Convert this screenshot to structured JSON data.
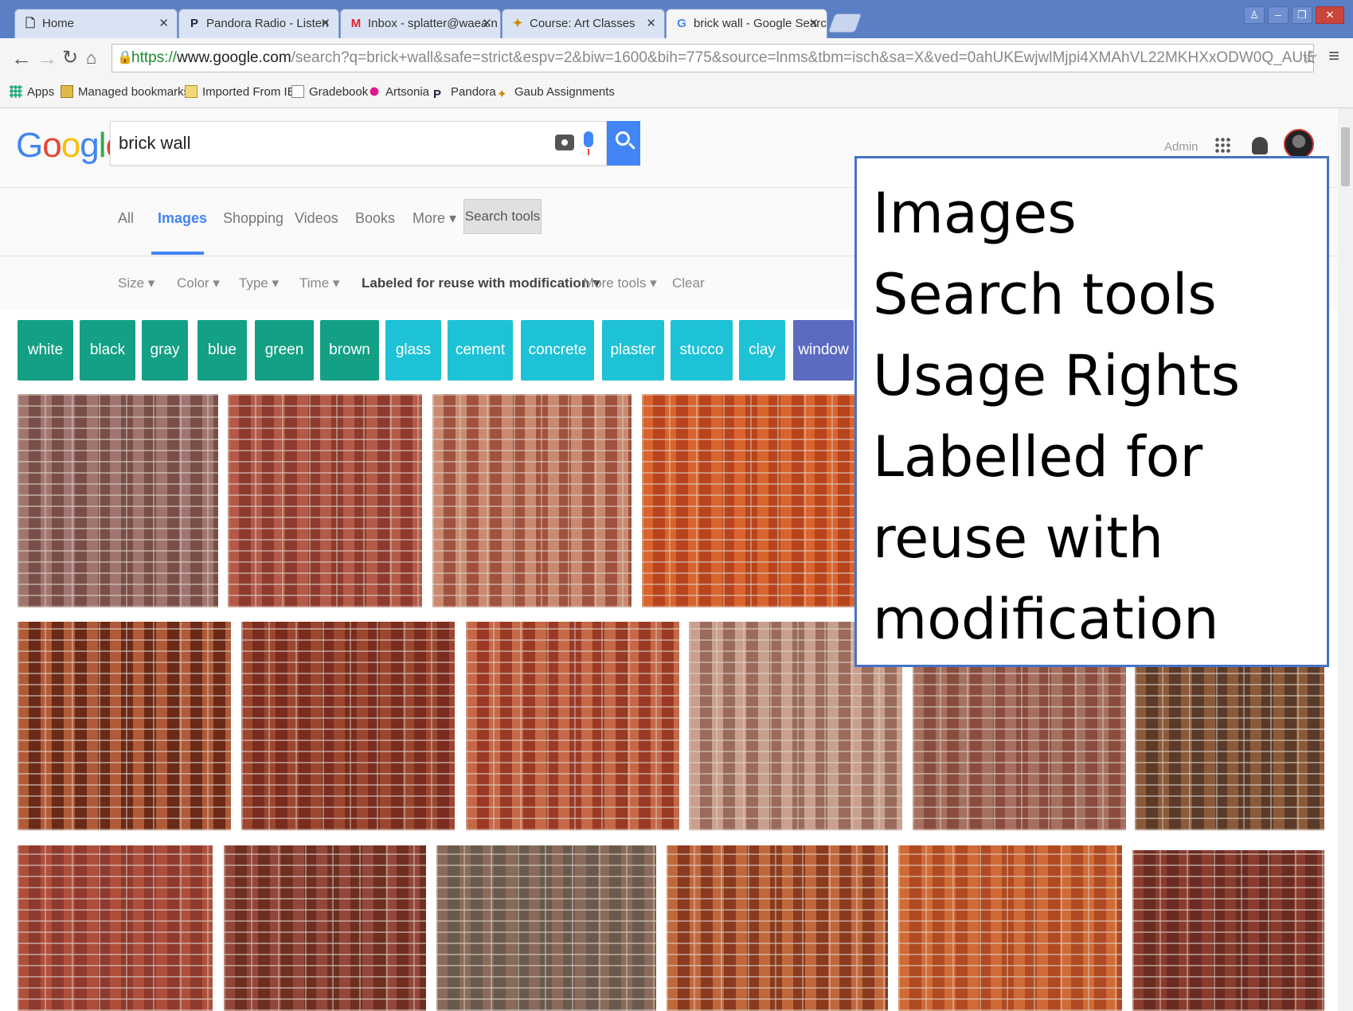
{
  "browser": {
    "tabs": [
      {
        "label": "Home",
        "favicon": "page-icon"
      },
      {
        "label": "Pandora Radio - Listen",
        "favicon": "pandora-icon"
      },
      {
        "label": "Inbox - splatter@waea.n",
        "favicon": "gmail-icon"
      },
      {
        "label": "Course: Art Classes",
        "favicon": "moodle-icon"
      },
      {
        "label": "brick wall - Google Search",
        "favicon": "google-icon"
      }
    ],
    "url_scheme": "https://",
    "url_host": "www.google.com",
    "url_rest": "/search?q=brick+wall&safe=strict&espv=2&biw=1600&bih=775&source=lnms&tbm=isch&sa=X&ved=0ahUKEwjwlMjpi4XMAhVL22MKHXxODW0Q_AUIBigB#q=brick+wall",
    "bookmarks": [
      "Apps",
      "Managed bookmarks",
      "Imported From IE",
      "Gradebook",
      "Artsonia",
      "Pandora",
      "Gaub Assignments"
    ]
  },
  "google": {
    "logo_text": "Google",
    "query": "brick wall",
    "account_name": "Admin",
    "nav_tabs": [
      "All",
      "Images",
      "Shopping",
      "Videos",
      "Books",
      "More ▾"
    ],
    "search_tools_label": "Search tools",
    "tools": [
      "Size ▾",
      "Color ▾",
      "Type ▾",
      "Time ▾",
      "Labeled for reuse with modification ▾",
      "More tools ▾",
      "Clear"
    ],
    "chips": [
      {
        "label": "white",
        "color": "#13a085"
      },
      {
        "label": "black",
        "color": "#13a085"
      },
      {
        "label": "gray",
        "color": "#13a085"
      },
      {
        "label": "blue",
        "color": "#13a085"
      },
      {
        "label": "green",
        "color": "#13a085"
      },
      {
        "label": "brown",
        "color": "#13a085"
      },
      {
        "label": "glass",
        "color": "#1ec2d6"
      },
      {
        "label": "cement",
        "color": "#1ec2d6"
      },
      {
        "label": "concrete",
        "color": "#1ec2d6"
      },
      {
        "label": "plaster",
        "color": "#1ec2d6"
      },
      {
        "label": "stucco",
        "color": "#1ec2d6"
      },
      {
        "label": "clay",
        "color": "#1ec2d6"
      },
      {
        "label": "window",
        "color": "#5c6bc0"
      }
    ]
  },
  "callout": {
    "lines": [
      "Images",
      "Search tools",
      "Usage Rights",
      "Labelled for",
      "reuse with",
      "modification"
    ]
  }
}
